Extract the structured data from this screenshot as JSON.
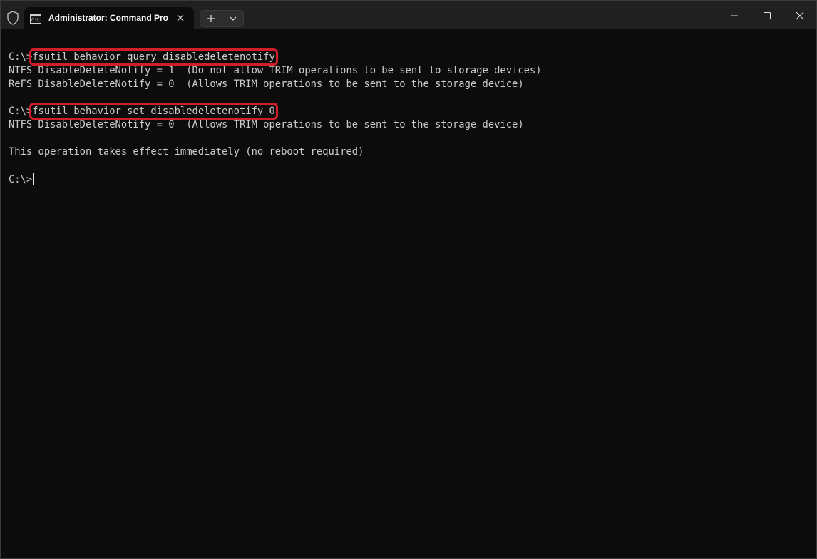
{
  "window": {
    "tab_title": "Administrator: Command Pro",
    "tab_icon": "terminal-icon",
    "shield_icon": "shield-icon",
    "new_tab_icon": "plus-icon",
    "dropdown_icon": "chevron-down-icon",
    "minimize_icon": "minimize-icon",
    "maximize_icon": "maximize-icon",
    "close_icon": "close-icon"
  },
  "terminal": {
    "lines": [
      {
        "prompt": "C:\\>",
        "command": "fsutil behavior query disabledeletenotify",
        "highlight": true
      },
      {
        "text": "NTFS DisableDeleteNotify = 1  (Do not allow TRIM operations to be sent to storage devices)"
      },
      {
        "text": "ReFS DisableDeleteNotify = 0  (Allows TRIM operations to be sent to the storage device)"
      },
      {
        "text": ""
      },
      {
        "prompt": "C:\\>",
        "command": "fsutil behavior set disabledeletenotify 0",
        "highlight": true
      },
      {
        "text": "NTFS DisableDeleteNotify = 0  (Allows TRIM operations to be sent to the storage device)"
      },
      {
        "text": ""
      },
      {
        "text": "This operation takes effect immediately (no reboot required)"
      },
      {
        "text": ""
      },
      {
        "prompt": "C:\\>",
        "command": "",
        "cursor": true
      }
    ]
  },
  "colors": {
    "background": "#0c0c0c",
    "titlebar": "#202020",
    "foreground": "#cccccc",
    "highlight_border": "#d21e2b"
  }
}
